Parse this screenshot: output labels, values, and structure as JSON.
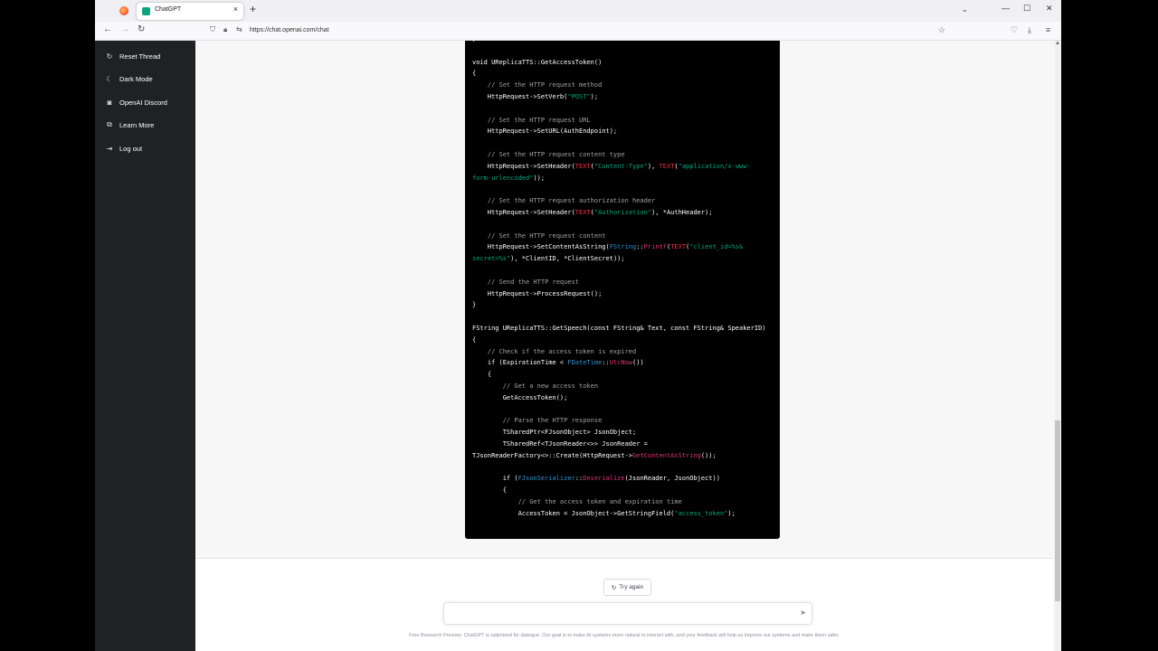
{
  "browser": {
    "tab_title": "ChatGPT",
    "tab_close": "×",
    "new_tab": "+",
    "tab_list": "⌄",
    "minimize": "—",
    "maximize": "☐",
    "close": "✕",
    "url": "https://chat.openai.com/chat",
    "back": "←",
    "forward": "→",
    "reload": "↻",
    "bookmark": "☆",
    "pocket": "♡",
    "download": "⤓",
    "menu": "≡"
  },
  "sidebar": {
    "items": [
      {
        "icon": "↻",
        "label": "Reset Thread"
      },
      {
        "icon": "☾",
        "label": "Dark Mode"
      },
      {
        "icon": "◙",
        "label": "OpenAI Discord"
      },
      {
        "icon": "⧉",
        "label": "Learn More"
      },
      {
        "icon": "⇥",
        "label": "Log out"
      }
    ]
  },
  "code_lines": [
    [
      {
        "t": "}"
      }
    ],
    [
      {
        "t": ""
      }
    ],
    [
      {
        "t": "void UReplicaTTS::GetAccessToken()"
      }
    ],
    [
      {
        "t": "{"
      }
    ],
    [
      {
        "t": "    "
      },
      {
        "t": "// Set the HTTP request method",
        "c": "cm"
      }
    ],
    [
      {
        "t": "    HttpRequest->SetVerb("
      },
      {
        "t": "\"POST\"",
        "c": "st"
      },
      {
        "t": ");"
      }
    ],
    [
      {
        "t": ""
      }
    ],
    [
      {
        "t": "    "
      },
      {
        "t": "// Set the HTTP request URL",
        "c": "cm"
      }
    ],
    [
      {
        "t": "    HttpRequest->SetURL(AuthEndpoint);"
      }
    ],
    [
      {
        "t": ""
      }
    ],
    [
      {
        "t": "    "
      },
      {
        "t": "// Set the HTTP request content type",
        "c": "cm"
      }
    ],
    [
      {
        "t": "    HttpRequest->SetHeader("
      },
      {
        "t": "TEXT",
        "c": "kw"
      },
      {
        "t": "("
      },
      {
        "t": "\"Content-Type\"",
        "c": "st"
      },
      {
        "t": "), "
      },
      {
        "t": "TEXT",
        "c": "kw"
      },
      {
        "t": "("
      },
      {
        "t": "\"application/x-www-",
        "c": "st"
      }
    ],
    [
      {
        "t": "form-urlencoded\"",
        "c": "st"
      },
      {
        "t": "));"
      }
    ],
    [
      {
        "t": ""
      }
    ],
    [
      {
        "t": "    "
      },
      {
        "t": "// Set the HTTP request authorization header",
        "c": "cm"
      }
    ],
    [
      {
        "t": "    HttpRequest->SetHeader("
      },
      {
        "t": "TEXT",
        "c": "kw"
      },
      {
        "t": "("
      },
      {
        "t": "\"Authorization\"",
        "c": "st"
      },
      {
        "t": "), *AuthHeader);"
      }
    ],
    [
      {
        "t": ""
      }
    ],
    [
      {
        "t": "    "
      },
      {
        "t": "// Set the HTTP request content",
        "c": "cm"
      }
    ],
    [
      {
        "t": "    HttpRequest->SetContentAsString("
      },
      {
        "t": "FString",
        "c": "ty"
      },
      {
        "t": "::"
      },
      {
        "t": "Printf",
        "c": "fn"
      },
      {
        "t": "("
      },
      {
        "t": "TEXT",
        "c": "kw"
      },
      {
        "t": "("
      },
      {
        "t": "\"client_id=%s&",
        "c": "st"
      }
    ],
    [
      {
        "t": "secret=%s\"",
        "c": "st"
      },
      {
        "t": "), *ClientID, *ClientSecret));"
      }
    ],
    [
      {
        "t": ""
      }
    ],
    [
      {
        "t": "    "
      },
      {
        "t": "// Send the HTTP request",
        "c": "cm"
      }
    ],
    [
      {
        "t": "    HttpRequest->ProcessRequest();"
      }
    ],
    [
      {
        "t": "}"
      }
    ],
    [
      {
        "t": ""
      }
    ],
    [
      {
        "t": "FString UReplicaTTS::GetSpeech(const FString& Text, const FString& SpeakerID)"
      }
    ],
    [
      {
        "t": "{"
      }
    ],
    [
      {
        "t": "    "
      },
      {
        "t": "// Check if the access token is expired",
        "c": "cm"
      }
    ],
    [
      {
        "t": "    if (ExpirationTime < "
      },
      {
        "t": "FDateTime",
        "c": "ty"
      },
      {
        "t": "::"
      },
      {
        "t": "UtcNow",
        "c": "fn"
      },
      {
        "t": "())"
      }
    ],
    [
      {
        "t": "    {"
      }
    ],
    [
      {
        "t": "        "
      },
      {
        "t": "// Get a new access token",
        "c": "cm"
      }
    ],
    [
      {
        "t": "        GetAccessToken();"
      }
    ],
    [
      {
        "t": ""
      }
    ],
    [
      {
        "t": "        "
      },
      {
        "t": "// Parse the HTTP response",
        "c": "cm"
      }
    ],
    [
      {
        "t": "        TSharedPtr<FJsonObject> JsonObject;"
      }
    ],
    [
      {
        "t": "        TSharedRef<TJsonReader<>> JsonReader ="
      }
    ],
    [
      {
        "t": "TJsonReaderFactory<>::Create(HttpRequest->"
      },
      {
        "t": "GetContentAsString",
        "c": "fn"
      },
      {
        "t": "());"
      }
    ],
    [
      {
        "t": ""
      }
    ],
    [
      {
        "t": "        if ("
      },
      {
        "t": "FJsonSerializer",
        "c": "ty"
      },
      {
        "t": "::"
      },
      {
        "t": "Deserialize",
        "c": "fn"
      },
      {
        "t": "(JsonReader, JsonObject))"
      }
    ],
    [
      {
        "t": "        {"
      }
    ],
    [
      {
        "t": "            "
      },
      {
        "t": "// Get the access token and expiration time",
        "c": "cm"
      }
    ],
    [
      {
        "t": "            AccessToken = JsonObject->GetStringField("
      },
      {
        "t": "\"access_token\"",
        "c": "st"
      },
      {
        "t": ");"
      }
    ]
  ],
  "actions": {
    "try_again_icon": "↻",
    "try_again": "Try again",
    "prompt_placeholder": "",
    "send_icon": "➤"
  },
  "footer": "Free Research Preview: ChatGPT is optimized for dialogue. Our goal is to make AI systems more natural to interact with, and your feedback will help us improve our systems and make them safer."
}
